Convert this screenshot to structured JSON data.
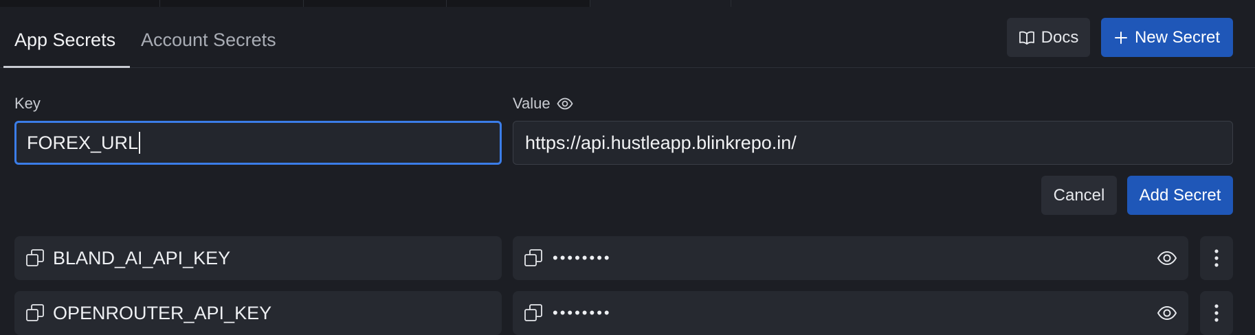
{
  "tabs": [
    {
      "label": "App Secrets",
      "active": true
    },
    {
      "label": "Account Secrets",
      "active": false
    }
  ],
  "toolbar": {
    "docs_label": "Docs",
    "docs_icon": "book-icon",
    "new_secret_label": "New Secret",
    "new_secret_icon": "plus-icon"
  },
  "form": {
    "key_label": "Key",
    "value_label": "Value",
    "value_label_icon": "eye-icon",
    "key_value": "FOREX_URL",
    "value_value": "https://api.hustleapp.blinkrepo.in/",
    "cancel_label": "Cancel",
    "add_label": "Add Secret"
  },
  "secrets": [
    {
      "key": "BLAND_AI_API_KEY",
      "value_masked": "••••••••"
    },
    {
      "key": "OPENROUTER_API_KEY",
      "value_masked": "••••••••"
    }
  ],
  "colors": {
    "background": "#1c1e24",
    "accent_blue": "#1f57b8",
    "focus_ring": "#3b7de8"
  }
}
